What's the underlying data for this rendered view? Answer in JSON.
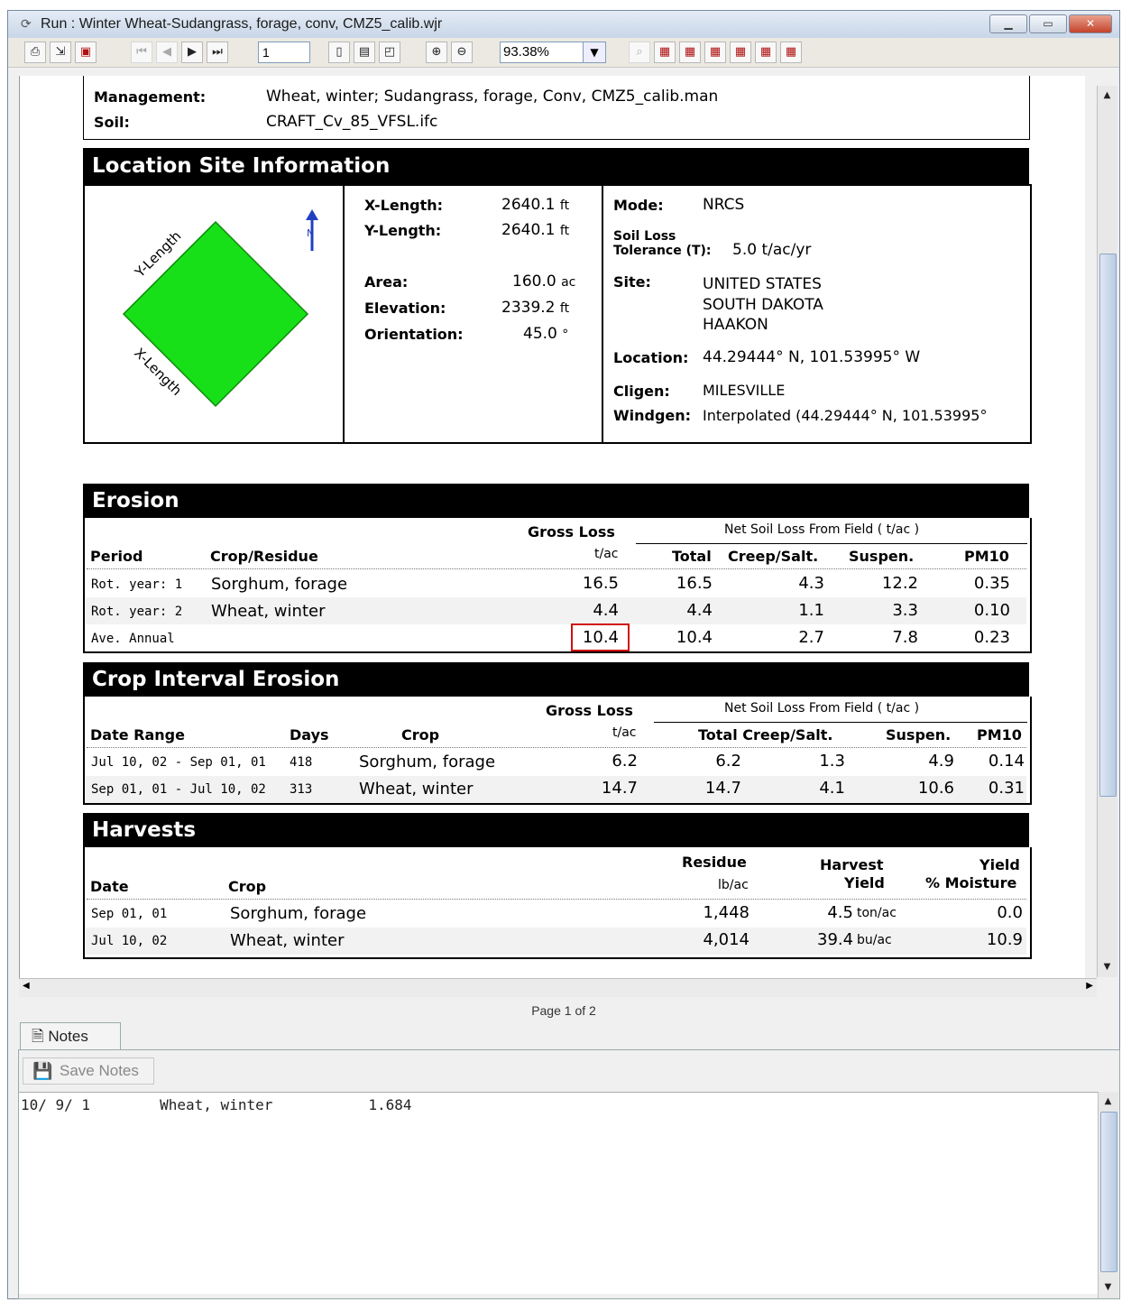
{
  "window": {
    "title": "Run : Winter Wheat-Sudangrass, forage, conv, CMZ5_calib.wjr",
    "icon": "refresh-icon"
  },
  "toolbar": {
    "page_value": "1",
    "zoom_value": "93.38%"
  },
  "report": {
    "management_label": "Management:",
    "management_value": "Wheat, winter; Sudangrass, forage, Conv, CMZ5_calib.man",
    "soil_label": "Soil:",
    "soil_value": "CRAFT_Cv_85_VFSL.ifc",
    "location": {
      "title": "Location Site Information",
      "diagram": {
        "y_label": "Y-Length",
        "x_label": "X-Length",
        "north": "N",
        "field_color": "#18e018"
      },
      "xlength_label": "X-Length:",
      "xlength_value": "2640.1",
      "xlength_unit": "ft",
      "ylength_label": "Y-Length:",
      "ylength_value": "2640.1",
      "ylength_unit": "ft",
      "area_label": "Area:",
      "area_value": "160.0",
      "area_unit": "ac",
      "elevation_label": "Elevation:",
      "elevation_value": "2339.2",
      "elevation_unit": "ft",
      "orientation_label": "Orientation:",
      "orientation_value": "45.0",
      "orientation_unit": "°",
      "mode_label": "Mode:",
      "mode_value": "NRCS",
      "tol_label_1": "Soil Loss",
      "tol_label_2": "Tolerance (T):",
      "tol_value": "5.0 t/ac/yr",
      "site_label": "Site:",
      "site_line1": "UNITED STATES",
      "site_line2": "SOUTH DAKOTA",
      "site_line3": "HAAKON",
      "loc_label": "Location:",
      "loc_value": "44.29444° N, 101.53995° W",
      "cligen_label": "Cligen:",
      "cligen_value": "MILESVILLE",
      "windgen_label": "Windgen:",
      "windgen_value": "Interpolated (44.29444° N, 101.53995°"
    },
    "erosion": {
      "title": "Erosion",
      "gross_loss": "Gross Loss",
      "net_soil": "Net Soil Loss From Field ( t/ac )",
      "col_period": "Period",
      "col_crop": "Crop/Residue",
      "col_unit": "t/ac",
      "col_total": "Total",
      "col_creep": "Creep/Salt.",
      "col_suspen": "Suspen.",
      "col_pm10": "PM10",
      "rows": [
        {
          "period": "Rot. year: 1",
          "crop": "Sorghum, forage",
          "gross": "16.5",
          "total": "16.5",
          "creep": "4.3",
          "suspen": "12.2",
          "pm10": "0.35"
        },
        {
          "period": "Rot. year: 2",
          "crop": "Wheat, winter",
          "gross": "4.4",
          "total": "4.4",
          "creep": "1.1",
          "suspen": "3.3",
          "pm10": "0.10"
        },
        {
          "period": "Ave. Annual",
          "crop": "",
          "gross": "10.4",
          "total": "10.4",
          "creep": "2.7",
          "suspen": "7.8",
          "pm10": "0.23"
        }
      ]
    },
    "crop_interval": {
      "title": "Crop Interval Erosion",
      "gross_loss": "Gross Loss",
      "net_soil": "Net Soil Loss From Field ( t/ac )",
      "col_date": "Date Range",
      "col_days": "Days",
      "col_crop": "Crop",
      "col_unit": "t/ac",
      "col_total": "Total Creep/Salt.",
      "col_suspen": "Suspen.",
      "col_pm10": "PM10",
      "rows": [
        {
          "range": "Jul 10, 02 - Sep 01, 01",
          "days": "418",
          "crop": "Sorghum, forage",
          "gross": "6.2",
          "total": "6.2",
          "creep": "1.3",
          "suspen": "4.9",
          "pm10": "0.14"
        },
        {
          "range": "Sep 01, 01 - Jul 10, 02",
          "days": "313",
          "crop": "Wheat, winter",
          "gross": "14.7",
          "total": "14.7",
          "creep": "4.1",
          "suspen": "10.6",
          "pm10": "0.31"
        }
      ]
    },
    "harvests": {
      "title": "Harvests",
      "col_date": "Date",
      "col_crop": "Crop",
      "col_residue": "Residue",
      "col_residue_unit": "lb/ac",
      "col_harvest1": "Harvest",
      "col_harvest2": "Yield",
      "col_yield1": "Yield",
      "col_yield2": "% Moisture",
      "rows": [
        {
          "date": "Sep 01, 01",
          "crop": "Sorghum, forage",
          "residue": "1,448",
          "yield": "4.5",
          "yield_unit": "ton/ac",
          "moisture": "0.0"
        },
        {
          "date": "Jul 10, 02",
          "crop": "Wheat, winter",
          "residue": "4,014",
          "yield": "39.4",
          "yield_unit": "bu/ac",
          "moisture": "10.9"
        }
      ]
    }
  },
  "pager": {
    "label": "Page 1 of 2"
  },
  "notes": {
    "tab_label": "Notes",
    "save_label": "Save Notes",
    "text": "10/ 9/ 1        Wheat, winter           1.684"
  }
}
